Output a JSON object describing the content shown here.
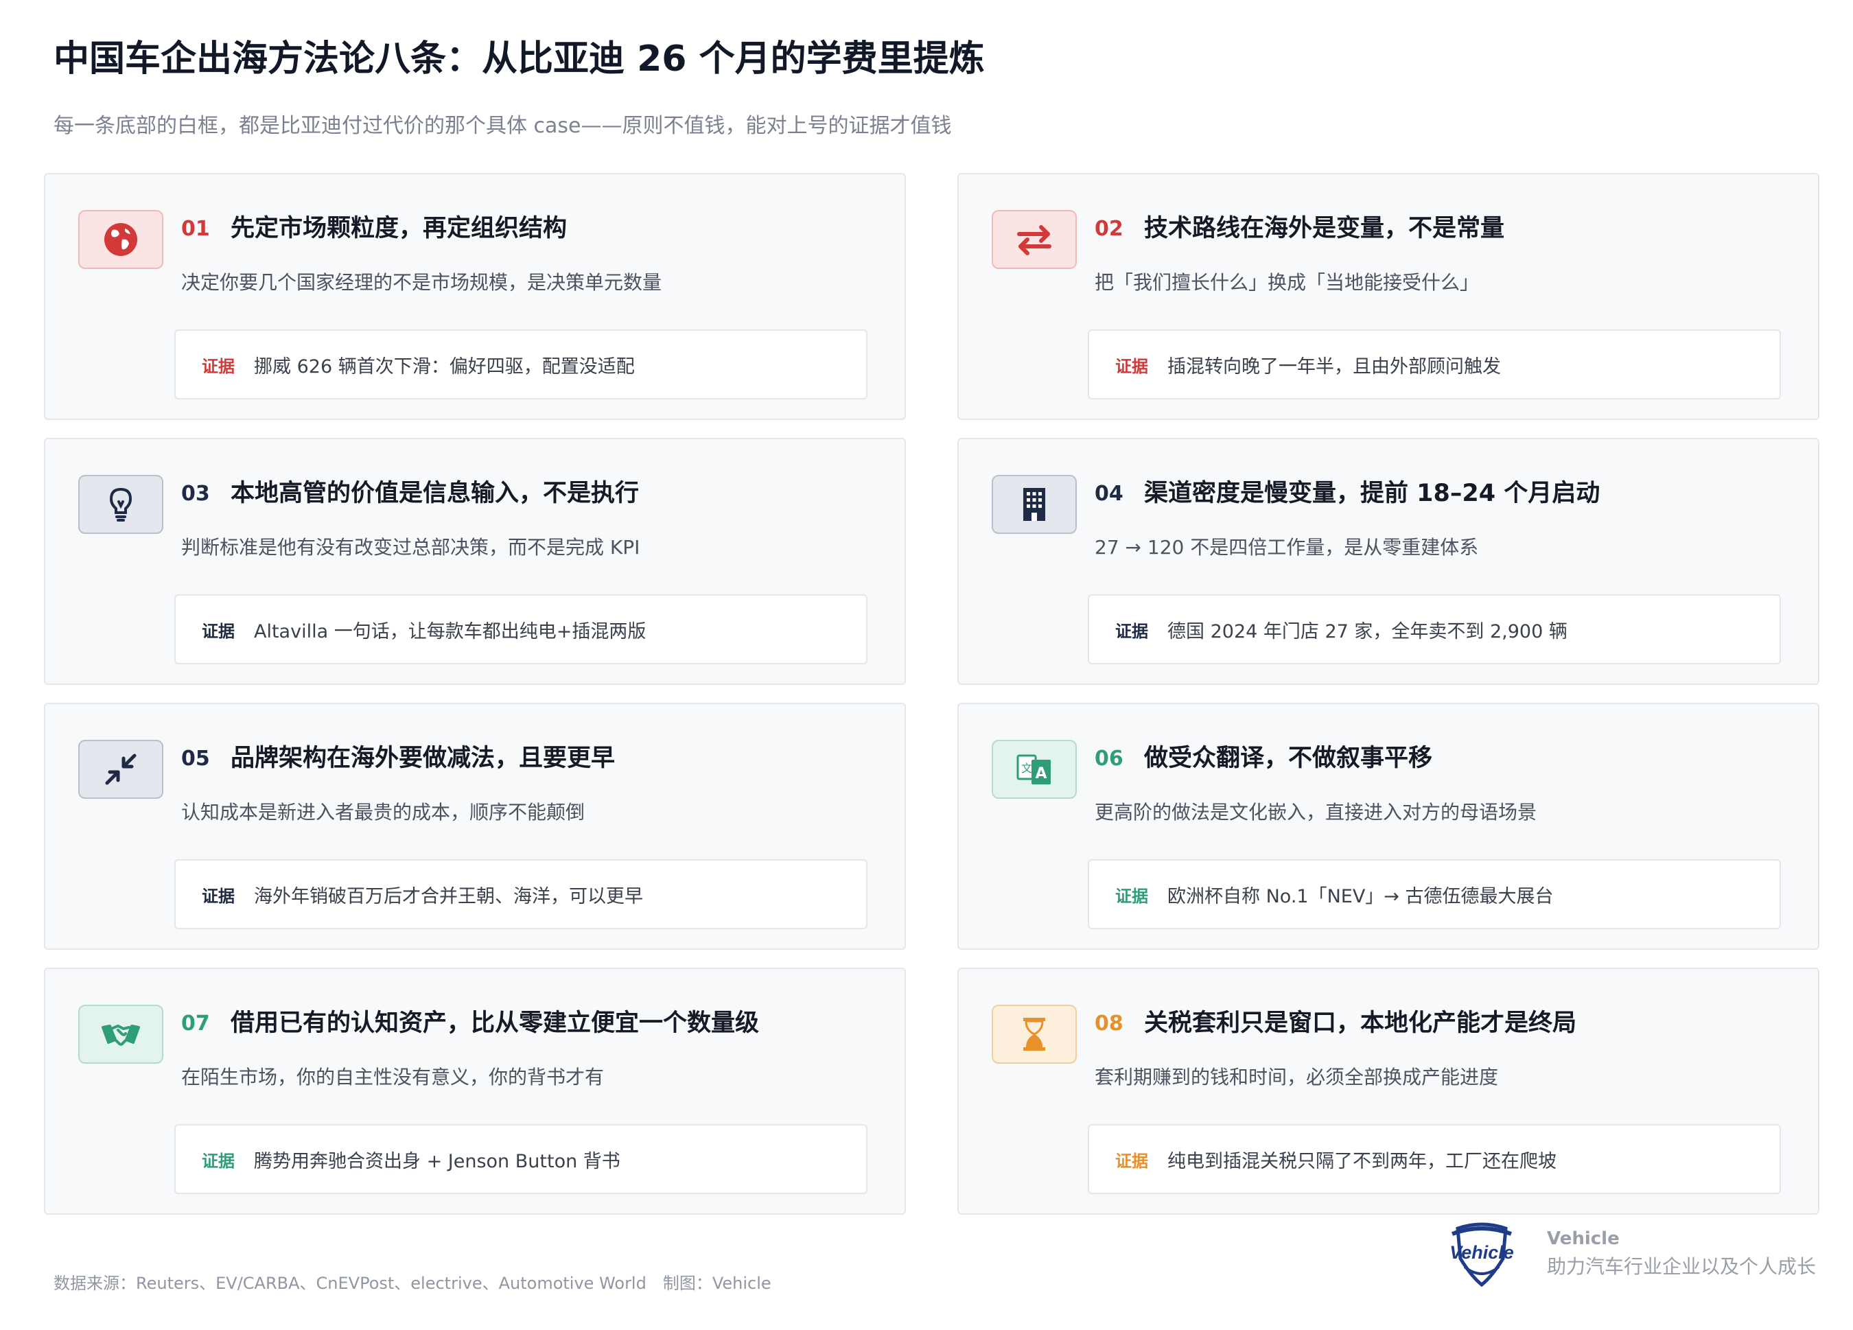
{
  "header": {
    "title": "中国车企出海方法论八条：从比亚迪 26 个月的学费里提炼",
    "subtitle": "每一条底部的白框，都是比亚迪付过代价的那个具体 case——原则不值钱，能对上号的证据才值钱"
  },
  "colors": {
    "red": "#d23a3a",
    "navy": "#1f2a44",
    "green": "#2f9e78",
    "orange": "#e8902a"
  },
  "cards": [
    {
      "num": "01",
      "title": "先定市场颗粒度，再定组织结构",
      "desc": "决定你要几个国家经理的不是市场规模，是决策单元数量",
      "evidence_label": "证据",
      "evidence": "挪威 626 辆首次下滑：偏好四驱，配置没适配",
      "icon": "globe-icon",
      "theme": "red"
    },
    {
      "num": "02",
      "title": "技术路线在海外是变量，不是常量",
      "desc": "把「我们擅长什么」换成「当地能接受什么」",
      "evidence_label": "证据",
      "evidence": "插混转向晚了一年半，且由外部顾问触发",
      "icon": "swap-arrows-icon",
      "theme": "red"
    },
    {
      "num": "03",
      "title": "本地高管的价值是信息输入，不是执行",
      "desc": "判断标准是他有没有改变过总部决策，而不是完成 KPI",
      "evidence_label": "证据",
      "evidence": "Altavilla 一句话，让每款车都出纯电+插混两版",
      "icon": "lightbulb-icon",
      "theme": "navy"
    },
    {
      "num": "04",
      "title": "渠道密度是慢变量，提前 18–24 个月启动",
      "desc": "27 → 120 不是四倍工作量，是从零重建体系",
      "evidence_label": "证据",
      "evidence": "德国 2024 年门店 27 家，全年卖不到 2,900 辆",
      "icon": "building-icon",
      "theme": "navy"
    },
    {
      "num": "05",
      "title": "品牌架构在海外要做减法，且要更早",
      "desc": "认知成本是新进入者最贵的成本，顺序不能颠倒",
      "evidence_label": "证据",
      "evidence": "海外年销破百万后才合并王朝、海洋，可以更早",
      "icon": "compress-arrows-icon",
      "theme": "navy"
    },
    {
      "num": "06",
      "title": "做受众翻译，不做叙事平移",
      "desc": "更高阶的做法是文化嵌入，直接进入对方的母语场景",
      "evidence_label": "证据",
      "evidence": "欧洲杯自称 No.1「NEV」→ 古德伍德最大展台",
      "icon": "translate-icon",
      "theme": "green"
    },
    {
      "num": "07",
      "title": "借用已有的认知资产，比从零建立便宜一个数量级",
      "desc": "在陌生市场，你的自主性没有意义，你的背书才有",
      "evidence_label": "证据",
      "evidence": "腾势用奔驰合资出身 + Jenson Button 背书",
      "icon": "handshake-icon",
      "theme": "green"
    },
    {
      "num": "08",
      "title": "关税套利只是窗口，本地化产能才是终局",
      "desc": "套利期赚到的钱和时间，必须全部换成产能进度",
      "evidence_label": "证据",
      "evidence": "纯电到插混关税只隔了不到两年，工厂还在爬坡",
      "icon": "hourglass-icon",
      "theme": "orange"
    }
  ],
  "footer": {
    "source": "数据来源：Reuters、EV/CARBA、CnEVPost、electrive、Automotive World　制图：Vehicle",
    "brand_name": "Vehicle",
    "brand_tagline": "助力汽车行业企业以及个人成长",
    "logo_text": "Vehicle"
  }
}
